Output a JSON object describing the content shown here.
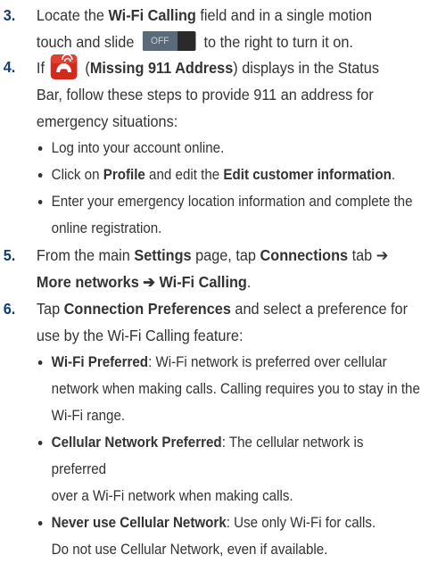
{
  "steps": [
    {
      "num": "3.",
      "line1_pre": "Locate the ",
      "line1_bold": "Wi-Fi Calling",
      "line1_post": " field and in a single motion",
      "line2_pre": "touch and slide",
      "toggle_label": "OFF",
      "line2_post": "to the right to turn it on."
    },
    {
      "num": "4.",
      "pre": "If",
      "icon": "missing-911-address-icon",
      "paren_open": " (",
      "bold": "Missing 911 Address",
      "post1": ") displays in the Status",
      "line2": "Bar, follow these steps to provide 911 an address for",
      "line3": "emergency situations:",
      "bullets": [
        {
          "text": "Log into your account online."
        },
        {
          "pre": "Click on ",
          "bold1": "Profile",
          "mid": " and edit the ",
          "bold2": "Edit customer information",
          "post": "."
        },
        {
          "line1": "Enter your emergency location information and complete the",
          "line2": "online registration."
        }
      ]
    },
    {
      "num": "5.",
      "pre": "From the main ",
      "bold1": "Settings",
      "mid": " page, tap ",
      "bold2": "Connections",
      "post": " tab ➔",
      "line2_bold": "More networks ➔ Wi-Fi Calling",
      "line2_post": "."
    },
    {
      "num": "6.",
      "pre": "Tap ",
      "bold": "Connection Preferences",
      "post": " and select a preference for",
      "line2": "use by the Wi-Fi Calling feature:",
      "bullets": [
        {
          "bold": "Wi-Fi Preferred",
          "line1": ": Wi-Fi network is preferred over cellular",
          "line2": "network when making calls. Calling requires you to stay in the",
          "line3": "Wi-Fi range."
        },
        {
          "bold": "Cellular Network Preferred",
          "line1": ": The cellular network is preferred",
          "line2": "over a Wi-Fi network when making calls."
        },
        {
          "bold": "Never use Cellular Network",
          "line1": ": Use only Wi-Fi for calls.",
          "line2": "Do not use Cellular Network, even if available."
        }
      ]
    }
  ],
  "colors": {
    "step_number": "#0f3d75",
    "body_text": "#333333",
    "icon_red": "#d42a1e"
  }
}
